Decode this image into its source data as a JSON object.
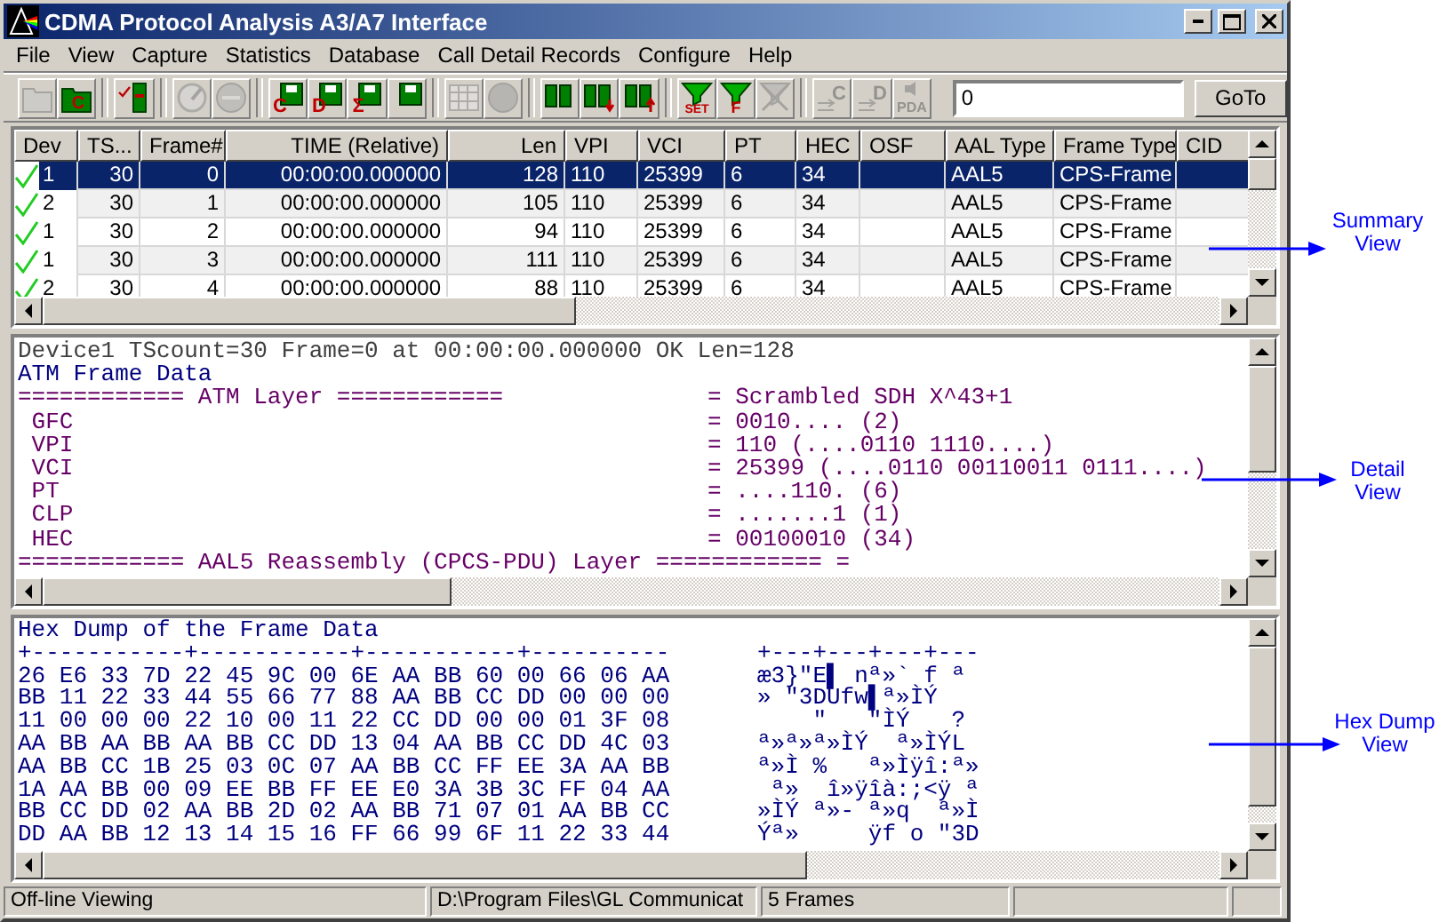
{
  "window": {
    "title": "CDMA Protocol Analysis A3/A7 Interface"
  },
  "menu": [
    "File",
    "View",
    "Capture",
    "Statistics",
    "Database",
    "Call Detail Records",
    "Configure",
    "Help"
  ],
  "toolbar": [
    [
      {
        "kind": "open-folder",
        "disabled": true
      },
      {
        "kind": "folder-letter",
        "label": "C",
        "disabled": false
      }
    ],
    [
      {
        "kind": "checklist",
        "disabled": false
      }
    ],
    [
      {
        "kind": "gauge",
        "disabled": true
      },
      {
        "kind": "stop",
        "disabled": true
      }
    ],
    [
      {
        "kind": "floppy-letter",
        "label": "C",
        "disabled": false
      },
      {
        "kind": "floppy-letter",
        "label": "D",
        "disabled": false
      },
      {
        "kind": "floppy-letter",
        "label": "Σ",
        "disabled": false
      },
      {
        "kind": "floppy",
        "disabled": false
      }
    ],
    [
      {
        "kind": "grid",
        "disabled": true
      },
      {
        "kind": "circle",
        "disabled": true
      }
    ],
    [
      {
        "kind": "binoculars",
        "disabled": false
      },
      {
        "kind": "binoculars-down",
        "disabled": false
      },
      {
        "kind": "binoculars-up",
        "disabled": false
      }
    ],
    [
      {
        "kind": "filter-letter",
        "label": "SET",
        "disabled": false
      },
      {
        "kind": "filter-letter",
        "label": "F",
        "disabled": false
      },
      {
        "kind": "filter-clear",
        "disabled": true
      }
    ],
    [
      {
        "kind": "arrows-letter",
        "label": "C",
        "disabled": true
      },
      {
        "kind": "arrows-letter",
        "label": "D",
        "disabled": true
      },
      {
        "kind": "speaker-letter",
        "label": "PDA",
        "disabled": true
      }
    ]
  ],
  "goto": {
    "value": "0",
    "button": "GoTo"
  },
  "summary": {
    "columns": [
      {
        "label": "Dev",
        "kind": "device"
      },
      {
        "label": "TS...",
        "kind": "number"
      },
      {
        "label": "Frame#",
        "kind": "number"
      },
      {
        "label": "TIME (Relative)",
        "kind": "number"
      },
      {
        "label": "Len",
        "kind": "number"
      },
      {
        "label": "VPI",
        "kind": "text"
      },
      {
        "label": "VCI",
        "kind": "text"
      },
      {
        "label": "PT",
        "kind": "text"
      },
      {
        "label": "HEC",
        "kind": "text"
      },
      {
        "label": "OSF",
        "kind": "text"
      },
      {
        "label": "AAL Type",
        "kind": "text"
      },
      {
        "label": "Frame Type",
        "kind": "text"
      },
      {
        "label": "CID",
        "kind": "text"
      }
    ],
    "rows": [
      {
        "selected": true,
        "ok": true,
        "cells": [
          "1",
          "30",
          "0",
          "00:00:00.000000",
          "128",
          "110",
          "25399",
          "6",
          "34",
          "",
          "AAL5",
          "CPS-Frame"
        ]
      },
      {
        "selected": false,
        "ok": true,
        "cells": [
          "2",
          "30",
          "1",
          "00:00:00.000000",
          "105",
          "110",
          "25399",
          "6",
          "34",
          "",
          "AAL5",
          "CPS-Frame"
        ]
      },
      {
        "selected": false,
        "ok": true,
        "cells": [
          "1",
          "30",
          "2",
          "00:00:00.000000",
          "94",
          "110",
          "25399",
          "6",
          "34",
          "",
          "AAL5",
          "CPS-Frame"
        ]
      },
      {
        "selected": false,
        "ok": true,
        "cells": [
          "1",
          "30",
          "3",
          "00:00:00.000000",
          "111",
          "110",
          "25399",
          "6",
          "34",
          "",
          "AAL5",
          "CPS-Frame"
        ]
      },
      {
        "selected": false,
        "ok": true,
        "cells": [
          "2",
          "30",
          "4",
          "00:00:00.000000",
          "88",
          "110",
          "25399",
          "6",
          "34",
          "",
          "AAL5",
          "CPS-Frame"
        ]
      }
    ]
  },
  "detail": [
    {
      "kind": "summary",
      "text": "Device1 TScount=30 Frame=0 at 00:00:00.000000 OK Len=128"
    },
    {
      "kind": "header",
      "text": "ATM Frame Data"
    },
    {
      "kind": "field",
      "name": "============ ATM Layer ============",
      "value": "= Scrambled SDH X^43+1"
    },
    {
      "kind": "field",
      "name": " GFC",
      "value": "= 0010.... (2)"
    },
    {
      "kind": "field",
      "name": " VPI",
      "value": "= 110 (....0110 1110....)"
    },
    {
      "kind": "field",
      "name": " VCI",
      "value": "= 25399 (....0110 00110011 0111....)"
    },
    {
      "kind": "field",
      "name": " PT",
      "value": "= ....110. (6)"
    },
    {
      "kind": "field",
      "name": " CLP",
      "value": "= .......1 (1)"
    },
    {
      "kind": "field",
      "name": " HEC",
      "value": "= 00100010 (34)"
    },
    {
      "kind": "line",
      "text": "============ AAL5 Reassembly (CPCS-PDU) Layer ============ ="
    }
  ],
  "hexdump": {
    "title": "Hex Dump of the Frame Data",
    "hex_rule": "+-----------+-----------+-----------+----------",
    "ascii_rule": "+---+---+---+---",
    "rows": [
      {
        "hex": "26 E6 33 7D 22 45 9C 00 6E AA BB 60 00 66 06 AA",
        "ascii": "æ3}\"E▌ nª»` f ª"
      },
      {
        "hex": "BB 11 22 33 44 55 66 77 88 AA BB CC DD 00 00 00",
        "ascii": "» \"3DUfw▌ª»ÌÝ"
      },
      {
        "hex": "11 00 00 00 22 10 00 11 22 CC DD 00 00 01 3F 08",
        "ascii": "    \"   \"ÌÝ   ?"
      },
      {
        "hex": "AA BB AA BB AA BB CC DD 13 04 AA BB CC DD 4C 03",
        "ascii": "ª»ª»ª»ÌÝ  ª»ÌÝL"
      },
      {
        "hex": "AA BB CC 1B 25 03 0C 07 AA BB CC FF EE 3A AA BB",
        "ascii": "ª»Ì %   ª»Ìÿî:ª»"
      },
      {
        "hex": "1A AA BB 00 09 EE BB FF EE E0 3A 3B 3C FF 04 AA",
        "ascii": " ª»  î»ÿîà:;<ÿ ª"
      },
      {
        "hex": "BB CC DD 02 AA BB 2D 02 AA BB 71 07 01 AA BB CC",
        "ascii": "»ÌÝ ª»- ª»q  ª»Ì"
      },
      {
        "hex": "DD AA BB 12 13 14 15 16 FF 66 99 6F 11 22 33 44",
        "ascii": "Ýª»     ÿf o \"3D"
      }
    ]
  },
  "status_bar": [
    "Off-line Viewing",
    "D:\\Program Files\\GL Communicat",
    "5 Frames"
  ],
  "annotations": [
    {
      "label": "Summary View"
    },
    {
      "label": "Detail View"
    },
    {
      "label": "Hex Dump View"
    }
  ]
}
